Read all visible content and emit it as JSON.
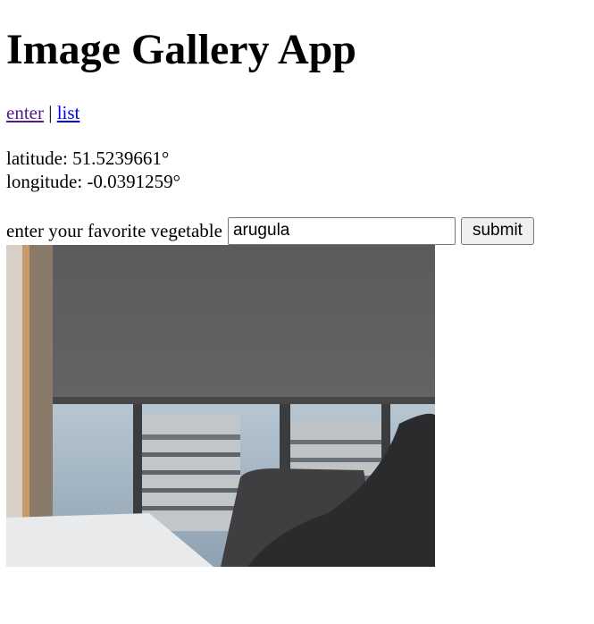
{
  "header": {
    "title": "Image Gallery App"
  },
  "nav": {
    "enter_label": "enter",
    "separator": "|",
    "list_label": "list"
  },
  "location": {
    "latitude_text": "latitude: 51.5239661°",
    "longitude_text": "longitude: -0.0391259°"
  },
  "form": {
    "label": "enter your favorite vegetable",
    "input_value": "arugula",
    "submit_label": "submit"
  }
}
